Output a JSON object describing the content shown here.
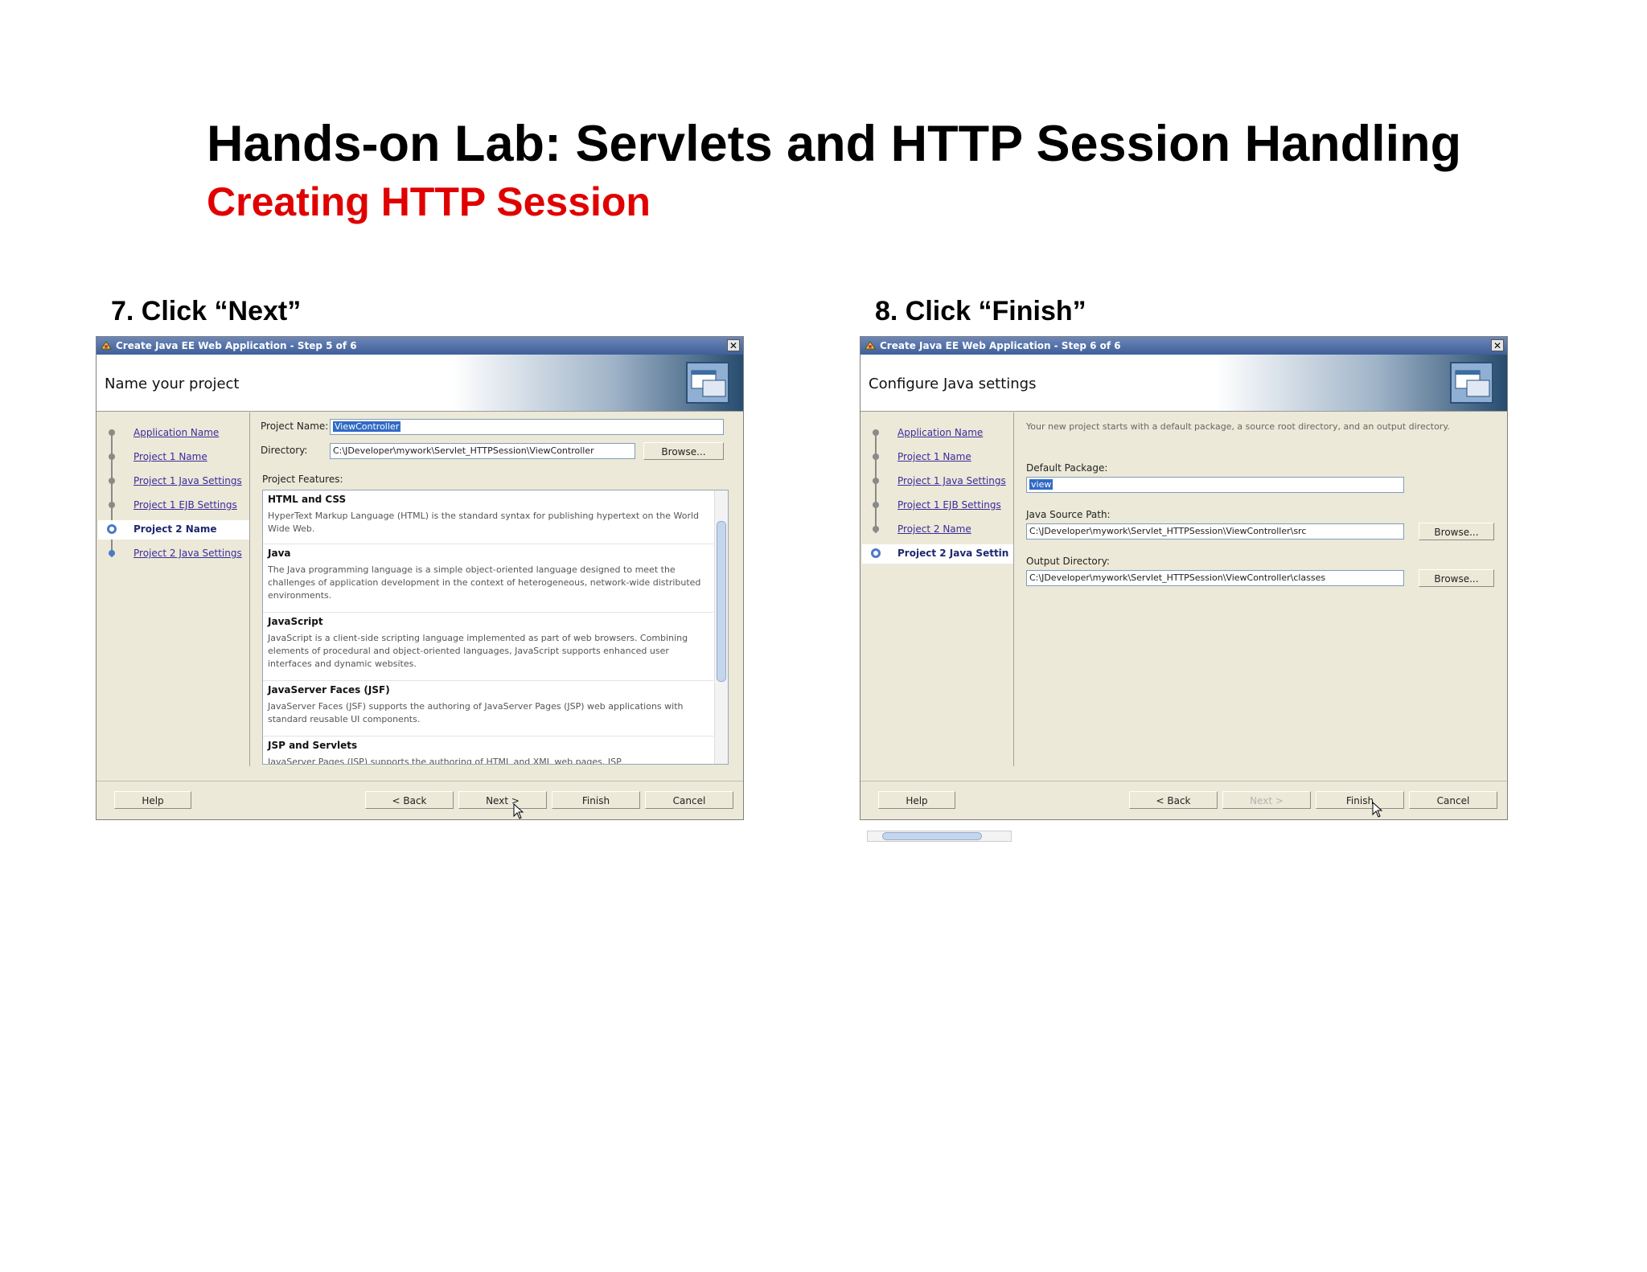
{
  "slide": {
    "title": "Hands-on Lab: Servlets and HTTP Session Handling",
    "subtitle": "Creating HTTP Session"
  },
  "steps": {
    "left_label": "7. Click “Next”",
    "right_label": "8. Click “Finish”"
  },
  "dialog_left": {
    "window_title": "Create Java EE Web Application - Step 5 of 6",
    "header": "Name your project",
    "nav": [
      {
        "label": "Application Name"
      },
      {
        "label": "Project 1 Name"
      },
      {
        "label": "Project 1 Java Settings"
      },
      {
        "label": "Project 1 EJB Settings"
      },
      {
        "label": "Project 2 Name"
      },
      {
        "label": "Project 2 Java Settings"
      }
    ],
    "project_name_label": "Project Name:",
    "project_name_value": "ViewController",
    "directory_label": "Directory:",
    "directory_value": "C:\\JDeveloper\\mywork\\Servlet_HTTPSession\\ViewController",
    "browse_label": "Browse...",
    "features_label": "Project Features:",
    "features": [
      {
        "name": "HTML and CSS",
        "desc": "HyperText Markup Language (HTML) is the standard syntax for publishing hypertext on the World Wide Web."
      },
      {
        "name": "Java",
        "desc": "The Java programming language is a simple object-oriented language designed to meet the challenges of application development in the context of heterogeneous, network-wide distributed environments."
      },
      {
        "name": "JavaScript",
        "desc": "JavaScript is a client-side scripting language implemented as part of web browsers. Combining elements of procedural and object-oriented languages, JavaScript supports enhanced user interfaces and dynamic websites."
      },
      {
        "name": "JavaServer Faces (JSF)",
        "desc": "JavaServer Faces (JSF) supports the authoring of JavaServer Pages (JSP) web applications with standard reusable UI components."
      },
      {
        "name": "JSP and Servlets",
        "desc": "JavaServer Pages (JSP) supports the authoring of HTML and XML web pages. JSP"
      }
    ],
    "buttons": {
      "help": "Help",
      "back": "< Back",
      "next": "Next >",
      "finish": "Finish",
      "cancel": "Cancel"
    }
  },
  "dialog_right": {
    "window_title": "Create Java EE Web Application - Step 6 of 6",
    "header": "Configure Java settings",
    "nav": [
      {
        "label": "Application Name"
      },
      {
        "label": "Project 1 Name"
      },
      {
        "label": "Project 1 Java Settings"
      },
      {
        "label": "Project 1 EJB Settings"
      },
      {
        "label": "Project 2 Name"
      },
      {
        "label": "Project 2 Java Settin"
      }
    ],
    "intro": "Your new project starts with a default package, a source root directory, and an output directory.",
    "default_package_label": "Default Package:",
    "default_package_value": "view",
    "java_source_label": "Java Source Path:",
    "java_source_value": "C:\\JDeveloper\\mywork\\Servlet_HTTPSession\\ViewController\\src",
    "output_label": "Output Directory:",
    "output_value": "C:\\JDeveloper\\mywork\\Servlet_HTTPSession\\ViewController\\classes",
    "browse_label": "Browse...",
    "buttons": {
      "help": "Help",
      "back": "< Back",
      "next": "Next >",
      "finish": "Finish",
      "cancel": "Cancel"
    }
  }
}
